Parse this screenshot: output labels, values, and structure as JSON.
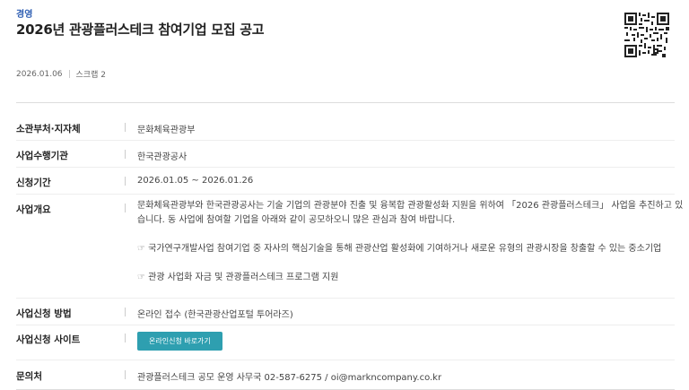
{
  "header": {
    "category": "경영",
    "title": "2026년 관광플러스테크 참여기업 모집 공고",
    "date": "2026.01.06",
    "scrap": "스크랩 2"
  },
  "details": {
    "dept": {
      "label": "소관부처·지자체",
      "value": "문화체육관광부"
    },
    "agency": {
      "label": "사업수행기관",
      "value": "한국관광공사"
    },
    "period": {
      "label": "신청기간",
      "value": "2026.01.05 ~ 2026.01.26"
    },
    "overview": {
      "label": "사업개요",
      "line1": "문화체육관광부와 한국관광공사는 기술 기업의 관광분야 진출 및 융복합 관광활성화 지원을 위하여 「2026 관광플러스테크」 사업을 추진하고 있",
      "line2": "습니다. 동 사업에 참여할 기업을 아래와 같이 공모하오니 많은 관심과 참여 바랍니다.",
      "bullet_glyph": "☞",
      "bullet1": "국가연구개발사업 참여기업 중 자사의 핵심기술을 통해 관광산업 활성화에 기여하거나 새로운 유형의 관광시장을 창출할 수 있는 중소기업",
      "bullet2": "관광 사업화 자금 및 관광플러스테크 프로그램 지원"
    },
    "method": {
      "label": "사업신청 방법",
      "value": "온라인 접수 (한국관광산업포털 투어라즈)"
    },
    "site": {
      "label": "사업신청 사이트",
      "button": "온라인신청 바로가기"
    },
    "contact": {
      "label": "문의처",
      "value": "관광플러스테크 공모 운영 사무국 02-587-6275 / oi@markncompany.co.kr"
    }
  }
}
